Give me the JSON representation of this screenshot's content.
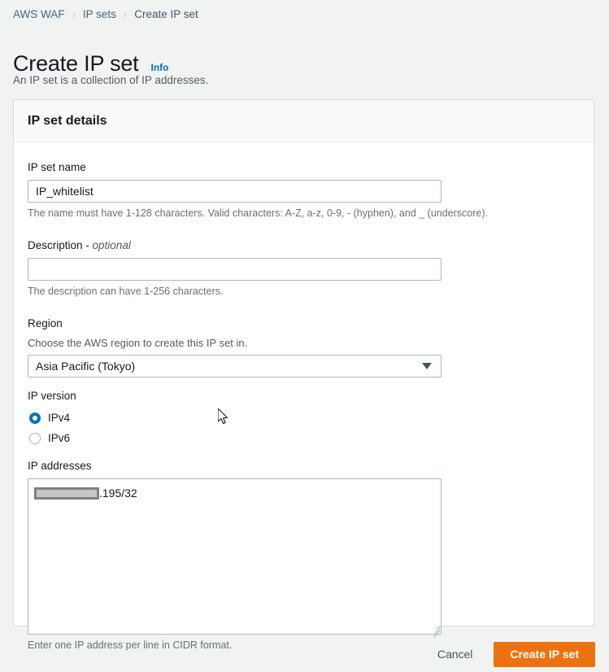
{
  "breadcrumb": {
    "items": [
      {
        "label": "AWS WAF",
        "type": "link"
      },
      {
        "label": "IP sets",
        "type": "link"
      },
      {
        "label": "Create IP set",
        "type": "current"
      }
    ],
    "separator": "›"
  },
  "page": {
    "title": "Create IP set",
    "info_label": "Info",
    "subtitle": "An IP set is a collection of IP addresses."
  },
  "panel": {
    "title": "IP set details",
    "name_field": {
      "label": "IP set name",
      "value": "IP_whitelist",
      "placeholder": "",
      "hint": "The name must have 1-128 characters. Valid characters: A-Z, a-z, 0-9, - (hyphen), and _ (underscore)."
    },
    "description_field": {
      "label": "Description - ",
      "label_optional": "optional",
      "value": "",
      "placeholder": "",
      "hint": "The description can have 1-256 characters."
    },
    "region_field": {
      "label": "Region",
      "description": "Choose the AWS region to create this IP set in.",
      "selected": "Asia Pacific (Tokyo)",
      "options": [
        "Asia Pacific (Tokyo)"
      ]
    },
    "ip_version_field": {
      "label": "IP version",
      "options": [
        {
          "label": "IPv4",
          "selected": true
        },
        {
          "label": "IPv6",
          "selected": false
        }
      ]
    },
    "ip_addresses_field": {
      "label": "IP addresses",
      "redacted": true,
      "value_suffix": ".195/32",
      "hint": "Enter one IP address per line in CIDR format."
    }
  },
  "footer": {
    "cancel_label": "Cancel",
    "submit_label": "Create IP set"
  },
  "colors": {
    "page_background": "#f1f3f3",
    "panel_background": "#ffffff",
    "accent_orange": "#ec7211",
    "link_blue": "#0073bb",
    "breadcrumb_link": "#44677b",
    "border": "#aab7b8"
  }
}
